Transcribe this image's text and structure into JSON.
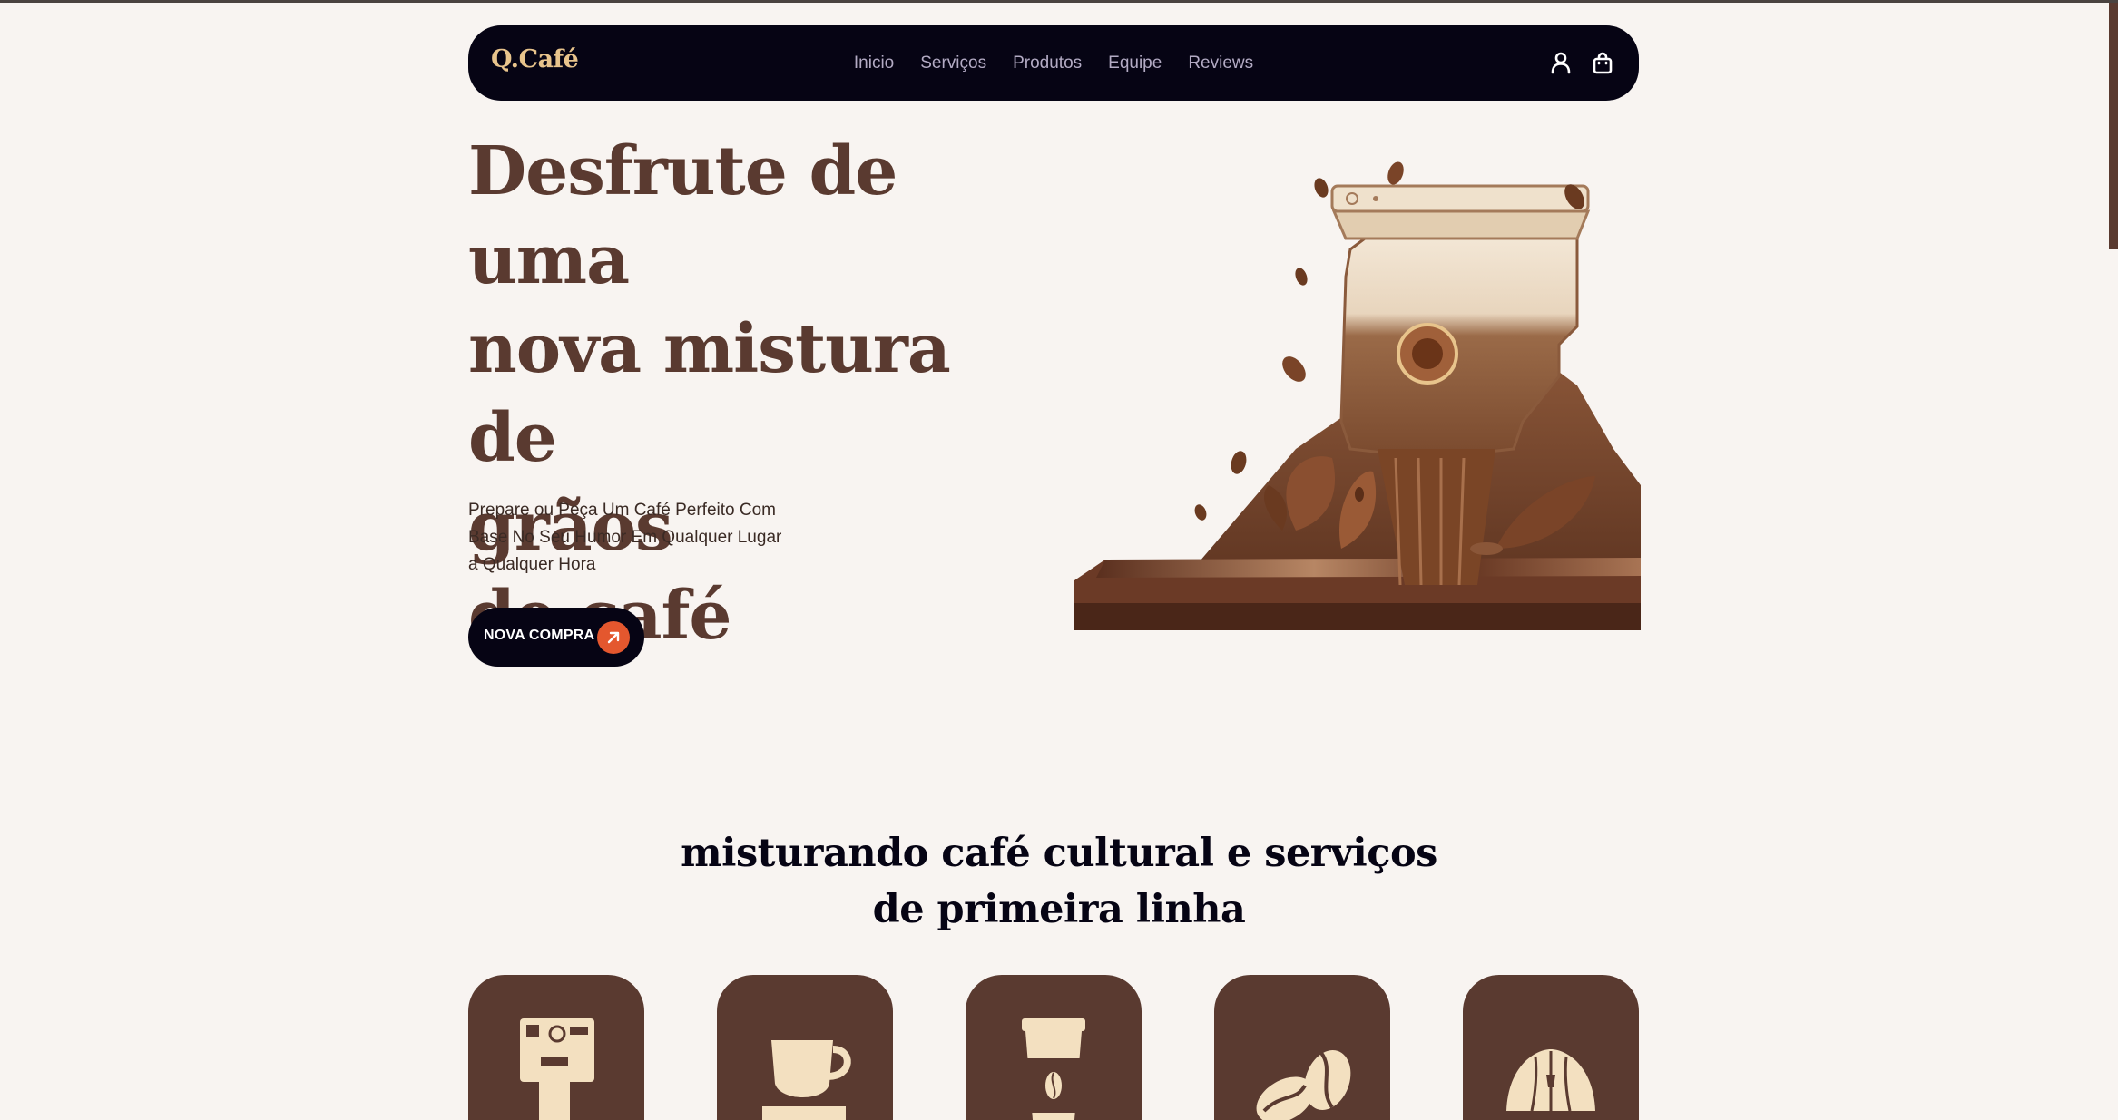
{
  "header": {
    "brand": "Q.Café",
    "nav": [
      "Inicio",
      "Serviços",
      "Produtos",
      "Equipe",
      "Reviews"
    ],
    "icons": [
      "user-icon",
      "shopping-bag-icon"
    ]
  },
  "hero": {
    "title_lines": [
      "Desfrute de uma",
      "nova mistura de",
      "grãos",
      "de café"
    ],
    "subtitle_lines": [
      "Prepare ou Peça Um Café Perfeito Com",
      "Base No Seu Humor Em Qualquer Lugar",
      "a Qualquer Hora"
    ],
    "cta_label": "NOVA COMPRA",
    "cta_icon": "arrow-up-right-icon",
    "image": "coffee-grinder-illustration"
  },
  "services": {
    "title_lines": [
      "misturando café cultural e serviços",
      "de primeira linha"
    ],
    "cards": [
      {
        "icon": "espresso-machine-icon"
      },
      {
        "icon": "coffee-cup-icon"
      },
      {
        "icon": "takeaway-cup-icon"
      },
      {
        "icon": "coffee-beans-icon"
      },
      {
        "icon": "croissant-icon"
      }
    ]
  },
  "colors": {
    "background": "#f8f4f1",
    "navbar": "#060414",
    "brand": "#e8c48c",
    "brown": "#5a3a30",
    "accent": "#e4572e",
    "nav_text": "#b3abc4"
  }
}
